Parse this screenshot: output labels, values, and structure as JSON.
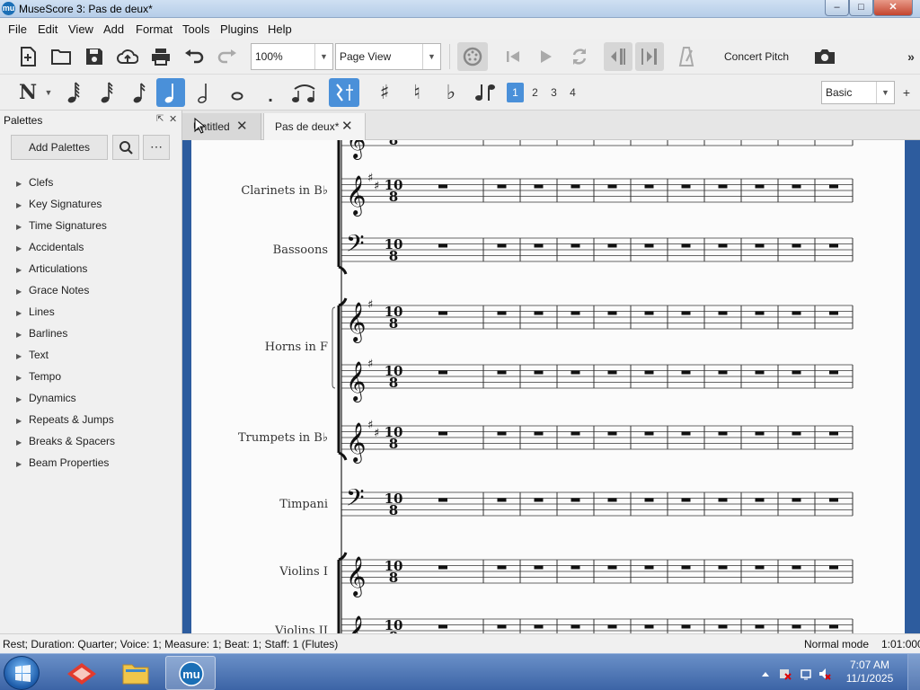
{
  "window": {
    "title": "MuseScore 3: Pas de deux*",
    "app_icon": "mu"
  },
  "menu": [
    "File",
    "Edit",
    "View",
    "Add",
    "Format",
    "Tools",
    "Plugins",
    "Help"
  ],
  "toolbar": {
    "zoom": "100%",
    "view_mode": "Page View",
    "concert_pitch": "Concert Pitch",
    "workspace": "Basic",
    "voices": [
      "1",
      "2",
      "3",
      "4"
    ],
    "active_voice": "1"
  },
  "palettes": {
    "title": "Palettes",
    "add_button": "Add Palettes",
    "items": [
      "Clefs",
      "Key Signatures",
      "Time Signatures",
      "Accidentals",
      "Articulations",
      "Grace Notes",
      "Lines",
      "Barlines",
      "Text",
      "Tempo",
      "Dynamics",
      "Repeats & Jumps",
      "Breaks & Spacers",
      "Beam Properties"
    ]
  },
  "tabs": [
    {
      "label": "Untitled",
      "active": false
    },
    {
      "label": "Pas de deux*",
      "active": true
    }
  ],
  "score": {
    "time_signature": {
      "numerator": "10",
      "denominator": "8"
    },
    "instruments": [
      "Clarinets in B♭",
      "Bassoons",
      "Horns in F",
      "Trumpets in B♭",
      "Timpani",
      "Violins I",
      "Violins II"
    ],
    "measures_visible": 11
  },
  "status": {
    "selection": "Rest; Duration: Quarter; Voice: 1;  Measure: 1; Beat: 1; Staff: 1 (Flutes)",
    "mode": "Normal mode",
    "time": "1:01:000"
  },
  "taskbar": {
    "time": "7:07 AM",
    "date": "11/1/2025"
  },
  "colors": {
    "accent": "#1b6fb6",
    "score_bg": "#2d5c9e",
    "selected_button": "#4a90d9"
  }
}
